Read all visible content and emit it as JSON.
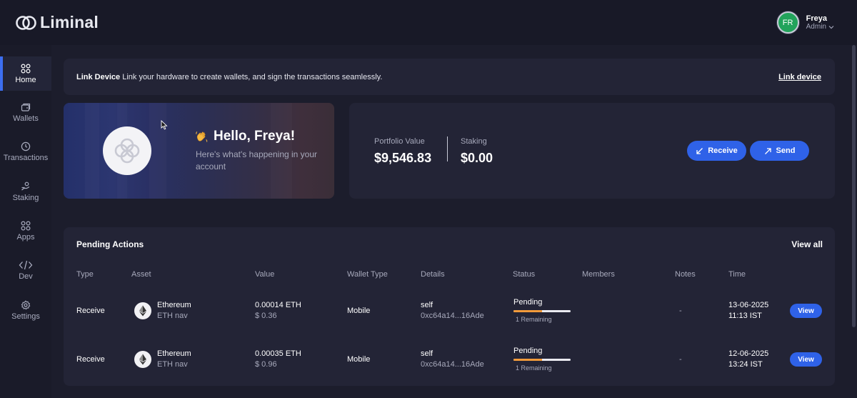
{
  "brand": {
    "name": "Liminal"
  },
  "user": {
    "initials": "FR",
    "name": "Freya",
    "role": "Admin"
  },
  "sidebar": {
    "items": [
      {
        "label": "Home",
        "icon": "home-grid-icon",
        "active": true
      },
      {
        "label": "Wallets",
        "icon": "wallet-icon"
      },
      {
        "label": "Transactions",
        "icon": "clock-icon"
      },
      {
        "label": "Staking",
        "icon": "staking-icon"
      },
      {
        "label": "Apps",
        "icon": "apps-grid-icon"
      },
      {
        "label": "Dev",
        "icon": "code-icon"
      },
      {
        "label": "Settings",
        "icon": "gear-icon"
      }
    ]
  },
  "banner": {
    "title": "Link Device",
    "text": "Link your hardware to create wallets, and sign the transactions seamlessly.",
    "link": "Link device"
  },
  "hello": {
    "greeting": "Hello, Freya!",
    "subtitle": "Here's what's happening in your account"
  },
  "portfolio": {
    "value_label": "Portfolio Value",
    "value": "$9,546.83",
    "staking_label": "Staking",
    "staking_value": "$0.00",
    "receive_label": "Receive",
    "send_label": "Send"
  },
  "pending": {
    "title": "Pending Actions",
    "view_all": "View all",
    "columns": [
      "Type",
      "Asset",
      "Value",
      "Wallet Type",
      "Details",
      "Status",
      "Members",
      "Notes",
      "Time"
    ],
    "rows": [
      {
        "type": "Receive",
        "asset": "Ethereum",
        "asset_sub": "ETH nav",
        "value": "0.00014 ETH",
        "value_usd": "$ 0.36",
        "wallet_type": "Mobile",
        "details": "self",
        "details_sub": "0xc64a14...16Ade",
        "status": "Pending",
        "status_progress": 0.5,
        "remaining": "1 Remaining",
        "notes": "-",
        "date": "13-06-2025",
        "time": "11:13 IST",
        "action": "View"
      },
      {
        "type": "Receive",
        "asset": "Ethereum",
        "asset_sub": "ETH nav",
        "value": "0.00035 ETH",
        "value_usd": "$ 0.96",
        "wallet_type": "Mobile",
        "details": "self",
        "details_sub": "0xc64a14...16Ade",
        "status": "Pending",
        "status_progress": 0.5,
        "remaining": "1 Remaining",
        "notes": "-",
        "date": "12-06-2025",
        "time": "13:24 IST",
        "action": "View"
      }
    ]
  },
  "colors": {
    "accent": "#2f62e8",
    "progress": "#f19a3b",
    "avatar": "#22a35b"
  }
}
